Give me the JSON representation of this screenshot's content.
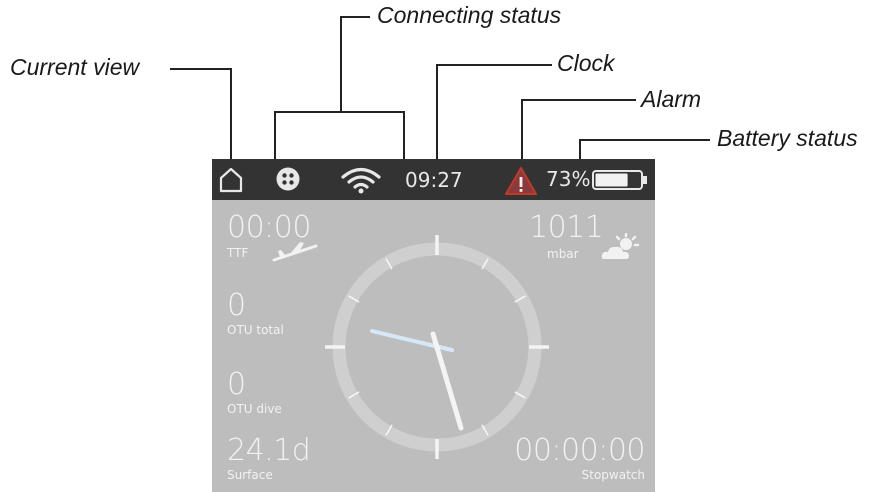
{
  "callouts": {
    "current_view": "Current view",
    "connecting_status": "Connecting status",
    "clock": "Clock",
    "alarm": "Alarm",
    "battery_status": "Battery status"
  },
  "status_bar": {
    "view_icon": "home-icon",
    "connect_icon": "bluetooth-dots-icon",
    "wifi_icon": "wifi-icon",
    "time": "09:27",
    "alarm_icon": "warning-triangle-icon",
    "alarm_color": "#c0392b",
    "battery_percent": "73%",
    "battery_level": 0.73
  },
  "screen": {
    "ttf": {
      "value": "00:00",
      "label": "TTF",
      "icon": "plane-landing-icon"
    },
    "pressure": {
      "value": "1011",
      "unit": "mbar",
      "icon": "partly-cloudy-icon"
    },
    "otu_total": {
      "value": "0",
      "label": "OTU total"
    },
    "otu_dive": {
      "value": "0",
      "label": "OTU dive"
    },
    "surface": {
      "value": "24.1d",
      "label": "Surface"
    },
    "stopwatch": {
      "value": "00:00:00",
      "label": "Stopwatch"
    }
  },
  "colors": {
    "background": "#bdbdbd",
    "status_bar": "#333333",
    "text": "#f2f2f2",
    "minute_hand_accent": "#d6e8f5"
  }
}
